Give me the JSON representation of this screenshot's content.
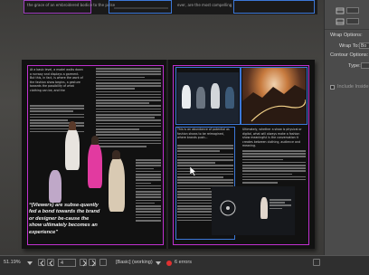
{
  "prev_spread": {
    "left_snippet": "the grace of an embroidered bodice to the pulse",
    "right_snippet": "ever, are the most compelling"
  },
  "left_page": {
    "quote": "“(Viewers) are subse-quently fed a bond towards the brand or designer be-cause the show ultimately becomes an experience”",
    "intro": "At a basic level, a model walks down a runway and displays a garment. But this, in fact, is where the work of the fashion show begins, a gesture towards the possibility of what clothing can be, and the"
  },
  "right_page": {
    "body_col": "This is an abundance of potential as fashion shows to be reimagined, where brands push...",
    "body_col2": "Ultimately, whether a show is physical or digital, what will always make a fashion show meaningful is the conversation it creates between clothing, audience and meaning."
  },
  "status_bar": {
    "zoom": "51.19%",
    "page_number": "4",
    "preflight_profile": "[Basic] (working)",
    "errors": "6 errors"
  },
  "panel": {
    "wrap_options_label": "Wrap Options:",
    "wrap_to_label": "Wrap To:",
    "wrap_to_value": "Bo",
    "contour_options_label": "Contour Options:",
    "type_label": "Type:",
    "include_inside_label": "Include Inside"
  },
  "colors": {
    "frame_magenta": "#c030d0",
    "frame_blue": "#3c78d8",
    "error_red": "#e03030"
  }
}
